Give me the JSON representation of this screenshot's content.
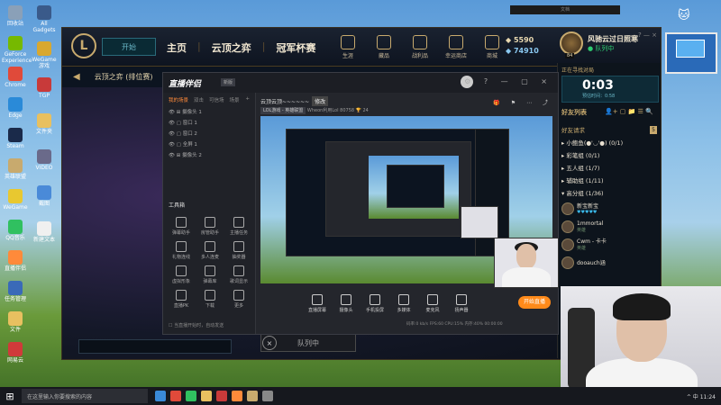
{
  "desktop": {
    "icons_left": [
      {
        "label": "回收站",
        "color": "#8aa0b8"
      },
      {
        "label": "GeForce Experience",
        "color": "#76b900"
      },
      {
        "label": "Chrome",
        "color": "#e04a3a"
      },
      {
        "label": "Edge",
        "color": "#2a8ad8"
      },
      {
        "label": "Steam",
        "color": "#1a2a4a"
      },
      {
        "label": "英雄联盟",
        "color": "#c8aa6e"
      },
      {
        "label": "WeGame",
        "color": "#e8c830"
      },
      {
        "label": "QQ音乐",
        "color": "#30c060"
      },
      {
        "label": "直播伴侣",
        "color": "#ff8a3a"
      },
      {
        "label": "任务管理",
        "color": "#3a6ab8"
      },
      {
        "label": "文件",
        "color": "#e8c060"
      },
      {
        "label": "网易云",
        "color": "#d03a3a"
      }
    ],
    "icons_mid": [
      {
        "label": "All Gadgets",
        "color": "#3a5a8a"
      },
      {
        "label": "WeGame 游戏",
        "color": "#d8a830"
      },
      {
        "label": "TGP",
        "color": "#c83a3a"
      },
      {
        "label": "文件夹",
        "color": "#e8c060"
      },
      {
        "label": "VIDEO",
        "color": "#6a6a8a"
      },
      {
        "label": "截图",
        "color": "#4a8ad8"
      },
      {
        "label": "新建文本",
        "color": "#f0f0f0"
      }
    ]
  },
  "taskbar": {
    "search_placeholder": "在这里输入你要搜索的内容",
    "tray": "^ 中 11:24",
    "apps": [
      "#3a8ad8",
      "#e04a3a",
      "#30c060",
      "#e8c060",
      "#c83a3a",
      "#ff8a3a",
      "#c8aa6e",
      "#888888"
    ]
  },
  "topbar": {
    "text": "文档"
  },
  "lol": {
    "logo": "L",
    "play_label": "开始",
    "nav": [
      "主页",
      "云顶之弈",
      "冠军杯赛"
    ],
    "icons": [
      {
        "label": "生涯"
      },
      {
        "label": "藏品"
      },
      {
        "label": "战利品"
      },
      {
        "label": "幸运商店"
      },
      {
        "label": "商城"
      }
    ],
    "rp": "5590",
    "be": "74910",
    "level": "84",
    "player_name": "风驰云过日照寒",
    "status": "● 队列中",
    "window_controls": "?  —  ×",
    "mode_title": "云顶之弈 (排位赛)",
    "queue_label": "队列中",
    "cancel_glyph": "×"
  },
  "friends": {
    "header": "正在寻找对局",
    "timer": "0:03",
    "timer_sub": "预估时间：0:58",
    "list_title": "好友列表",
    "tools": "👤+ ▢ 📁 ☰ 🔍",
    "requests_label": "好友请求",
    "requests_count": "5",
    "groups": [
      "小鲍鱼(●'◡'●) (0/1)",
      "彩笔组 (0/1)",
      "五人组 (1/7)",
      "辅助组 (1/11)",
      "高分组 (1/36)"
    ],
    "friends": [
      {
        "name": "新宝新宝",
        "status": "♥♥♥♥♥"
      },
      {
        "name": "1mmortal",
        "status": "英雄"
      },
      {
        "name": "Cwm - 卡卡",
        "status": "英雄"
      },
      {
        "name": "dooauch涵",
        "status": ""
      }
    ]
  },
  "stream": {
    "logo": "直播伴侣",
    "badge": "新版",
    "window_controls": "⚙ ? — ▢ ×",
    "tabs": [
      "我的场景",
      "双击",
      "可信场",
      "场景"
    ],
    "scenes": [
      "摄像头 1",
      "窗口 1",
      "窗口 2",
      "全屏 1",
      "摄像头 2"
    ],
    "tools_title": "工具箱",
    "tools": [
      "弹幕助手",
      "房管助手",
      "主播任务",
      "礼物连线",
      "多人连麦",
      "抽奖器",
      "虚拟形象",
      "弹幕库",
      "歌词显示",
      "直播PK",
      "下载",
      "更多"
    ],
    "footer": "☐ 当直播开始时，自动发送",
    "room_title": "云顶云顶~~~~~~",
    "room_title_btn": "修改",
    "meta_category": "LOL游戏 - 英雄联盟",
    "meta_text": "Wheon利用LoI   80758   🏆 24",
    "right_icons": "🎁 ⚑ ⋯ ⤴",
    "bottom_tools": [
      "直播屏幕",
      "摄像头",
      "手机投屏",
      "多媒体",
      "麦克风",
      "扬声器"
    ],
    "go_live": "开始直播",
    "stats": "码率:0 kb/s   FPS:60   CPU:15%   内存:40%   00:00:00"
  }
}
